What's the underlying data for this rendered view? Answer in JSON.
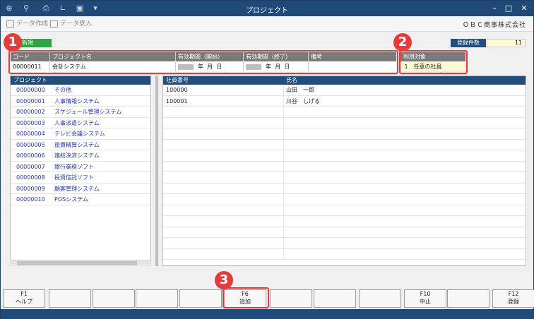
{
  "window": {
    "title": "プロジェクト"
  },
  "titlebar_icons": [
    "search-plus-icon",
    "zoom-icon",
    "printer-icon",
    "ruler-icon",
    "export-icon",
    "dropdown-icon"
  ],
  "toolbar": {
    "create_data": "データ作成",
    "import_data": "データ受入",
    "company": "ＯＢＣ商事株式会社"
  },
  "mode": {
    "badge": "新規"
  },
  "count": {
    "label": "登録件数",
    "value": "11"
  },
  "header_table": {
    "columns": [
      "コード",
      "プロジェクト名",
      "有効期間（開始）",
      "有効期間（終了）",
      "備考"
    ],
    "row": {
      "code": "00000011",
      "name": "会計システム",
      "start_year": "年",
      "start_month": "月",
      "start_day": "日",
      "end_year": "年",
      "end_month": "月",
      "end_day": "日",
      "note": ""
    }
  },
  "target": {
    "header": "利用対象",
    "num": "1",
    "value": "任意の社員"
  },
  "markers": {
    "m1": "1",
    "m2": "2",
    "m3": "3"
  },
  "project_list": {
    "header": "プロジェクト",
    "items": [
      {
        "code": "00000000",
        "name": "その他"
      },
      {
        "code": "00000001",
        "name": "人事情報システム"
      },
      {
        "code": "00000002",
        "name": "スケジュール管理システム"
      },
      {
        "code": "00000003",
        "name": "人事派遣システム"
      },
      {
        "code": "00000004",
        "name": "テレビ会議システム"
      },
      {
        "code": "00000005",
        "name": "旅費精算システム"
      },
      {
        "code": "00000006",
        "name": "連結決済システム"
      },
      {
        "code": "00000007",
        "name": "銀行業務ソフト"
      },
      {
        "code": "00000008",
        "name": "投資信託ソフト"
      },
      {
        "code": "00000009",
        "name": "顧客管理システム"
      },
      {
        "code": "00000010",
        "name": "POSシステム"
      }
    ]
  },
  "employee_table": {
    "columns": [
      "社員番号",
      "氏名"
    ],
    "rows": [
      {
        "id": "100000",
        "name": "山田　一郎"
      },
      {
        "id": "100001",
        "name": "川谷　しげる"
      }
    ]
  },
  "fkeys": [
    {
      "num": "F1",
      "label": "ヘルプ"
    },
    {
      "num": "",
      "label": ""
    },
    {
      "num": "",
      "label": ""
    },
    {
      "num": "",
      "label": ""
    },
    {
      "num": "",
      "label": ""
    },
    {
      "num": "F6",
      "label": "追加"
    },
    {
      "num": "",
      "label": ""
    },
    {
      "num": "",
      "label": ""
    },
    {
      "num": "",
      "label": ""
    },
    {
      "num": "F10",
      "label": "中止"
    },
    {
      "num": "",
      "label": ""
    },
    {
      "num": "F12",
      "label": "登録"
    }
  ],
  "colors": {
    "titlebar": "#1f4a78",
    "accent_red": "#e63b3b",
    "mode_green": "#2fa347",
    "link_blue": "#2638b8"
  }
}
